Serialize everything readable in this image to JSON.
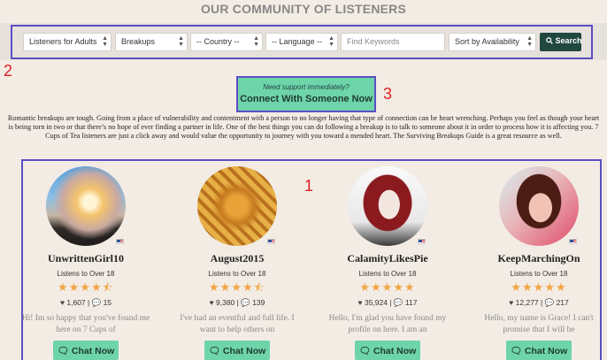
{
  "page": {
    "title": "OUR COMMUNITY OF LISTENERS"
  },
  "filters": {
    "audience": "Listeners for Adults",
    "topic": "Breakups",
    "country": "-- Country --",
    "language": "-- Language --",
    "keywords_placeholder": "Find Keywords",
    "sort": "Sort by Availability",
    "search_label": "Search"
  },
  "annotations": [
    "1",
    "2",
    "3"
  ],
  "support": {
    "line1": "Need support immediately?",
    "line2": "Connect With Someone Now"
  },
  "intro": "Romantic breakups are tough. Going from a place of vulnerability and contentment with a person to no longer having that type of connection can be heart wrenching. Perhaps you feel as though your heart is being torn in two or that there’s no hope of ever finding a partner in life. One of the best things you can do following a breakup is to talk to someone about it in order to process how it is affecting you. 7 Cups of Tea listeners are just a click away and would value the opportunity to journey with you toward a mended heart. The Surviving Breakups Guide is a great resource as well.",
  "listeners": [
    {
      "name": "UnwrittenGirl10",
      "age": "Listens to Over 18",
      "stars": "★★★★⯪",
      "rating": 4.5,
      "hearts": "1,607",
      "chats": "15",
      "bio": "Hi! Im so happy that you've found me here on 7 Cups of",
      "chat_label": "Chat Now"
    },
    {
      "name": "August2015",
      "age": "Listens to Over 18",
      "stars": "★★★★⯪",
      "rating": 4.5,
      "hearts": "9,380",
      "chats": "139",
      "bio": "I've had an eventful and full life. I want to help others on",
      "chat_label": "Chat Now"
    },
    {
      "name": "CalamityLikesPie",
      "age": "Listens to Over 18",
      "stars": "★★★★★",
      "rating": 5,
      "hearts": "35,924",
      "chats": "117",
      "bio": "Hello, I'm glad you have found my profile on here. I am an",
      "chat_label": "Chat Now"
    },
    {
      "name": "KeepMarchingOn",
      "age": "Listens to Over 18",
      "stars": "★★★★★",
      "rating": 5,
      "hearts": "12,277",
      "chats": "217",
      "bio": "Hello, my name is Grace! I can't promise that I will be",
      "chat_label": "Chat Now"
    }
  ]
}
